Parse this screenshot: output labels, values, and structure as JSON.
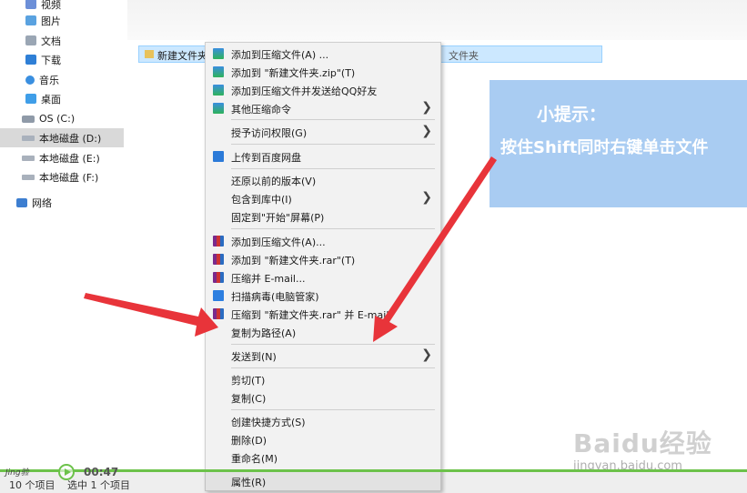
{
  "nav": {
    "items": [
      {
        "label": "视频",
        "icon": "video-icon"
      },
      {
        "label": "图片",
        "icon": "pictures-icon"
      },
      {
        "label": "文档",
        "icon": "documents-icon"
      },
      {
        "label": "下载",
        "icon": "downloads-icon"
      },
      {
        "label": "音乐",
        "icon": "music-icon"
      },
      {
        "label": "桌面",
        "icon": "desktop-icon"
      },
      {
        "label": "OS (C:)",
        "icon": "os-drive-icon"
      },
      {
        "label": "本地磁盘 (D:)",
        "icon": "local-disk-icon",
        "selected": true
      },
      {
        "label": "本地磁盘 (E:)",
        "icon": "local-disk-icon"
      },
      {
        "label": "本地磁盘 (F:)",
        "icon": "local-disk-icon"
      },
      {
        "label": "网络",
        "icon": "network-icon"
      }
    ]
  },
  "file_list": {
    "row": {
      "name": "新建文件夹",
      "type": "文件夹"
    }
  },
  "context_menu": {
    "items": [
      {
        "label": "添加到压缩文件(A) ...",
        "icon": "zip-icon"
      },
      {
        "label": "添加到 \"新建文件夹.zip\"(T)",
        "icon": "zip-icon"
      },
      {
        "label": "添加到压缩文件并发送给QQ好友",
        "icon": "zip-icon"
      },
      {
        "label": "其他压缩命令",
        "icon": "zip-icon",
        "submenu": true
      },
      {
        "label": "授予访问权限(G)",
        "submenu": true
      },
      {
        "label": "上传到百度网盘",
        "icon": "baidu-cloud-icon"
      },
      {
        "label": "还原以前的版本(V)"
      },
      {
        "label": "包含到库中(I)",
        "submenu": true
      },
      {
        "label": "固定到\"开始\"屏幕(P)"
      },
      {
        "label": "添加到压缩文件(A)...",
        "icon": "winrar-icon"
      },
      {
        "label": "添加到 \"新建文件夹.rar\"(T)",
        "icon": "winrar-icon"
      },
      {
        "label": "压缩并 E-mail...",
        "icon": "winrar-icon"
      },
      {
        "label": "扫描病毒(电脑管家)",
        "icon": "shield-icon"
      },
      {
        "label": "压缩到 \"新建文件夹.rar\" 并 E-mail",
        "icon": "winrar-icon"
      },
      {
        "label": "复制为路径(A)"
      },
      {
        "label": "发送到(N)",
        "submenu": true
      },
      {
        "label": "剪切(T)"
      },
      {
        "label": "复制(C)"
      },
      {
        "label": "创建快捷方式(S)"
      },
      {
        "label": "删除(D)"
      },
      {
        "label": "重命名(M)"
      },
      {
        "label": "属性(R)"
      }
    ],
    "submenu_arrow": "❯"
  },
  "tip": {
    "title": "小提示：",
    "body": "按住Shift同时右键单击文件"
  },
  "status": {
    "item_count": "10 个项目",
    "selected": "选中 1 个项目"
  },
  "video": {
    "time": "00:47",
    "brand": "Jing验"
  },
  "watermark": {
    "logo": "Baidu经验",
    "url": "jingyan.baidu.com"
  },
  "colors": {
    "tip_box": "#a9ccf2",
    "selection": "#cce8ff",
    "arrow": "#e8343a",
    "progress": "#6cc24a"
  }
}
